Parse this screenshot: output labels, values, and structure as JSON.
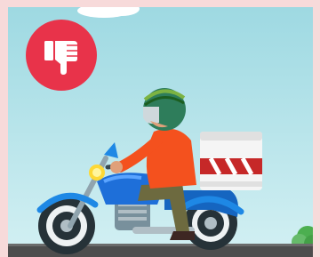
{
  "colors": {
    "frame": "#f7dada",
    "sky_top": "#9ed9e2",
    "sky_bottom": "#cfeef2",
    "badge": "#e8334a",
    "road": "#4d4d4d"
  },
  "badge": {
    "icon": "thumbs-down-icon"
  }
}
